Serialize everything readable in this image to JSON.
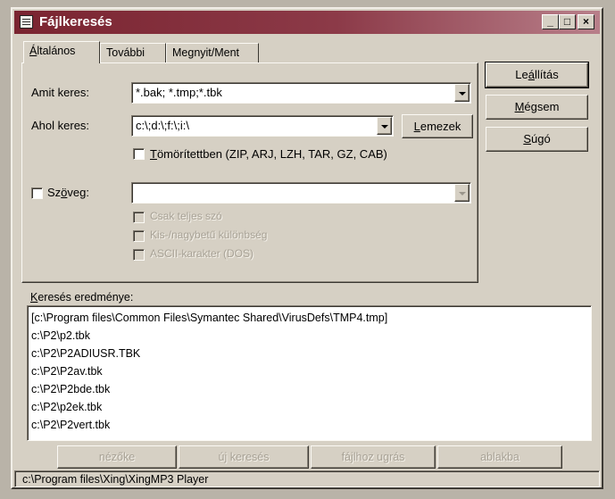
{
  "window": {
    "title": "Fájlkeresés"
  },
  "title_buttons": {
    "minimize": "_",
    "maximize": "□",
    "close": "×"
  },
  "tabs": [
    {
      "label": "Általános",
      "underline": "Á",
      "rest": "ltalános"
    },
    {
      "label": "További"
    },
    {
      "label": "Megnyit/Ment"
    }
  ],
  "form": {
    "search_label": "Amit keres:",
    "search_value": "*.bak; *.tmp;*.tbk",
    "where_label": "Ahol keres:",
    "where_value": "c:\\;d:\\;f:\\;i:\\",
    "drives_button": {
      "underline": "L",
      "rest": "emezek"
    },
    "compressed_checkbox": {
      "underline": "T",
      "rest": "ömörítettben (ZIP, ARJ, LZH, TAR, GZ, CAB)",
      "checked": false
    },
    "text_checkbox": {
      "pre": "Sz",
      "underline": "ö",
      "rest": "veg:",
      "checked": false
    },
    "text_value": "",
    "whole_word": "Csak teljes szó",
    "case_sensitive": "Kis-/nagybetű különbség",
    "ascii_chars": "ASCII-karakter (DOS)"
  },
  "side_buttons": {
    "stop": {
      "pre": "Le",
      "underline": "á",
      "rest": "llítás"
    },
    "cancel": {
      "underline": "M",
      "rest": "égsem"
    },
    "help": {
      "underline": "S",
      "rest": "úgó"
    }
  },
  "results": {
    "label_underline": "K",
    "label_rest": "eresés eredménye:",
    "items": [
      "[c:\\Program files\\Common Files\\Symantec Shared\\VirusDefs\\TMP4.tmp]",
      "c:\\P2\\p2.tbk",
      "c:\\P2\\P2ADIUSR.TBK",
      "c:\\P2\\P2av.tbk",
      "c:\\P2\\P2bde.tbk",
      "c:\\P2\\p2ek.tbk",
      "c:\\P2\\P2vert.tbk"
    ]
  },
  "bottom_buttons": [
    "nézőke",
    "új keresés",
    "fájlhoz ugrás",
    "ablakba"
  ],
  "status": "c:\\Program files\\Xing\\XingMP3 Player",
  "colors": {
    "title_start": "#7a2430",
    "title_end": "#b87f8a",
    "face": "#d6d0c4"
  }
}
